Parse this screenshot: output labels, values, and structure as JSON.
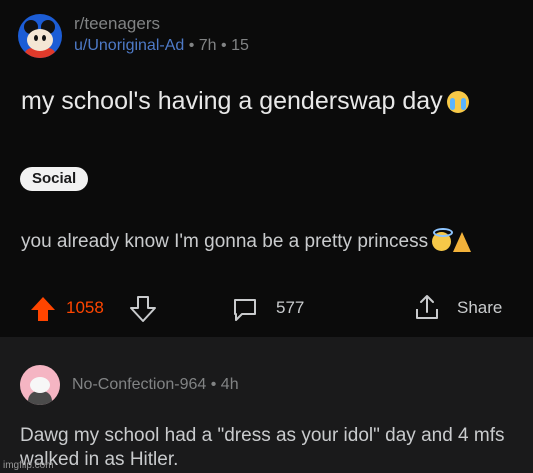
{
  "post": {
    "subreddit": "r/teenagers",
    "username": "u/Unoriginal-Ad",
    "meta_rest": " • 7h • 15",
    "title": "my school's having a genderswap day",
    "flair": "Social",
    "body": "you already know I'm gonna be a pretty princess",
    "upvotes": "1058",
    "comments": "577",
    "share_label": "Share"
  },
  "comment": {
    "username": "No-Confection-964",
    "meta_rest": " • 4h",
    "text": "Dawg my school had a \"dress as your idol\" day and 4 mfs walked in as Hitler."
  },
  "watermark": "imgflip.com",
  "colors": {
    "upvote": "#ff4500",
    "username_link": "#4e7ac7",
    "background": "#0b0b0b",
    "comment_background": "#1a1a1b"
  },
  "icons": [
    "subreddit-avatar",
    "crying-face-icon",
    "halo-face-icon",
    "praying-hands-icon",
    "upvote-arrow-icon",
    "downvote-arrow-icon",
    "comment-bubble-icon",
    "share-icon",
    "user-avatar"
  ]
}
